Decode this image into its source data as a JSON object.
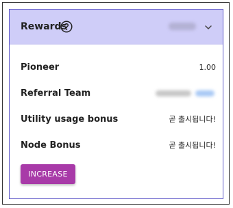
{
  "rewards": {
    "title": "Rewards",
    "help_icon": "help-circle-icon",
    "expand_icon": "chevron-down-icon",
    "rows": [
      {
        "label": "Pioneer",
        "value": "1.00"
      },
      {
        "label": "Referral Team",
        "value": ""
      },
      {
        "label": "Utility usage bonus",
        "value": "곧 출시됩니다!"
      },
      {
        "label": "Node Bonus",
        "value": "곧 출시됩니다!"
      }
    ],
    "button_label": "INCREASE"
  },
  "colors": {
    "header_bg": "#cfcdf8",
    "border": "#5b55c7",
    "button_bg": "#a83aa8",
    "button_text": "#ffffff"
  }
}
